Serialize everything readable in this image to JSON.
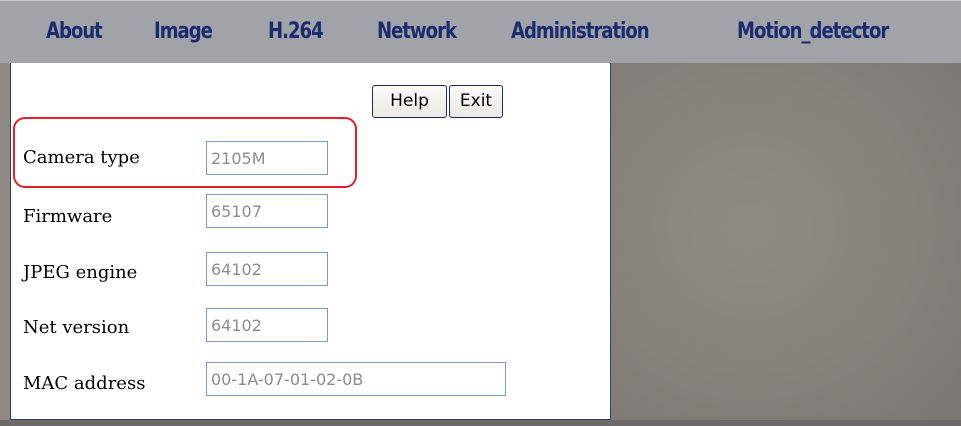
{
  "nav": {
    "items": [
      {
        "label": "About"
      },
      {
        "label": "Image"
      },
      {
        "label": "H.264"
      },
      {
        "label": "Network"
      },
      {
        "label": "Administration"
      },
      {
        "label": "Motion_detector"
      }
    ]
  },
  "panel": {
    "help_label": "Help",
    "exit_label": "Exit",
    "rows": [
      {
        "label": "Camera type",
        "value": "2105M"
      },
      {
        "label": "Firmware",
        "value": "65107"
      },
      {
        "label": "JPEG engine",
        "value": "64102"
      },
      {
        "label": "Net version",
        "value": "64102"
      },
      {
        "label": "MAC address",
        "value": "00-1A-07-01-02-0B"
      }
    ]
  },
  "colors": {
    "nav_background": "#a0a4a9",
    "nav_text": "#1d2a6e",
    "highlight_border": "#e0202a",
    "field_text": "#8d8d8d",
    "video_background": "#8e8a86"
  }
}
